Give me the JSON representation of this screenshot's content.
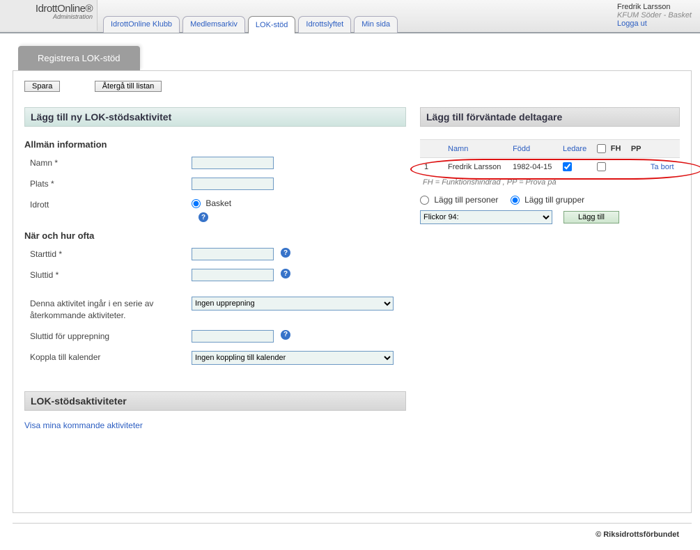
{
  "logo": {
    "main": "IdrottOnline®",
    "sub": "Administration"
  },
  "tabs": [
    {
      "label": "IdrottOnline Klubb"
    },
    {
      "label": "Medlemsarkiv"
    },
    {
      "label": "LOK-stöd",
      "active": true
    },
    {
      "label": "Idrottslyftet"
    },
    {
      "label": "Min sida"
    }
  ],
  "user": {
    "name": "Fredrik Larsson",
    "org": "KFUM Söder - Basket",
    "logout": "Logga ut"
  },
  "page_title": "Registrera LOK-stöd",
  "buttons": {
    "save": "Spara",
    "back": "Återgå till listan"
  },
  "left": {
    "header": "Lägg till ny LOK-stödsaktivitet",
    "section1": "Allmän information",
    "labels": {
      "name": "Namn *",
      "place": "Plats *",
      "sport": "Idrott",
      "sport_option": "Basket"
    },
    "section2": "När och hur ofta",
    "labels2": {
      "start": "Starttid *",
      "end": "Sluttid *",
      "repeat": "Denna aktivitet ingår i en serie av återkommande aktiviteter.",
      "repeat_option": "Ingen upprepning",
      "end_repeat": "Sluttid för upprepning",
      "calendar": "Koppla till kalender",
      "calendar_option": "Ingen koppling till kalender"
    },
    "sub_header": "LOK-stödsaktiviteter",
    "link": "Visa mina kommande aktiviteter"
  },
  "right": {
    "header": "Lägg till förväntade deltagare",
    "table": {
      "cols": {
        "name": "Namn",
        "born": "Född",
        "leader": "Ledare",
        "fh": "FH",
        "pp": "PP"
      },
      "rows": [
        {
          "idx": "1",
          "name": "Fredrik Larsson",
          "born": "1982-04-15",
          "leader": true,
          "fh": false,
          "remove": "Ta bort"
        }
      ]
    },
    "hint": "FH = Funktionshindrad , PP = Prova på",
    "radio": {
      "persons": "Lägg till personer",
      "groups": "Lägg till grupper"
    },
    "dropdown": "Flickor 94:",
    "add": "Lägg till"
  },
  "footer": "© Riksidrottsförbundet"
}
